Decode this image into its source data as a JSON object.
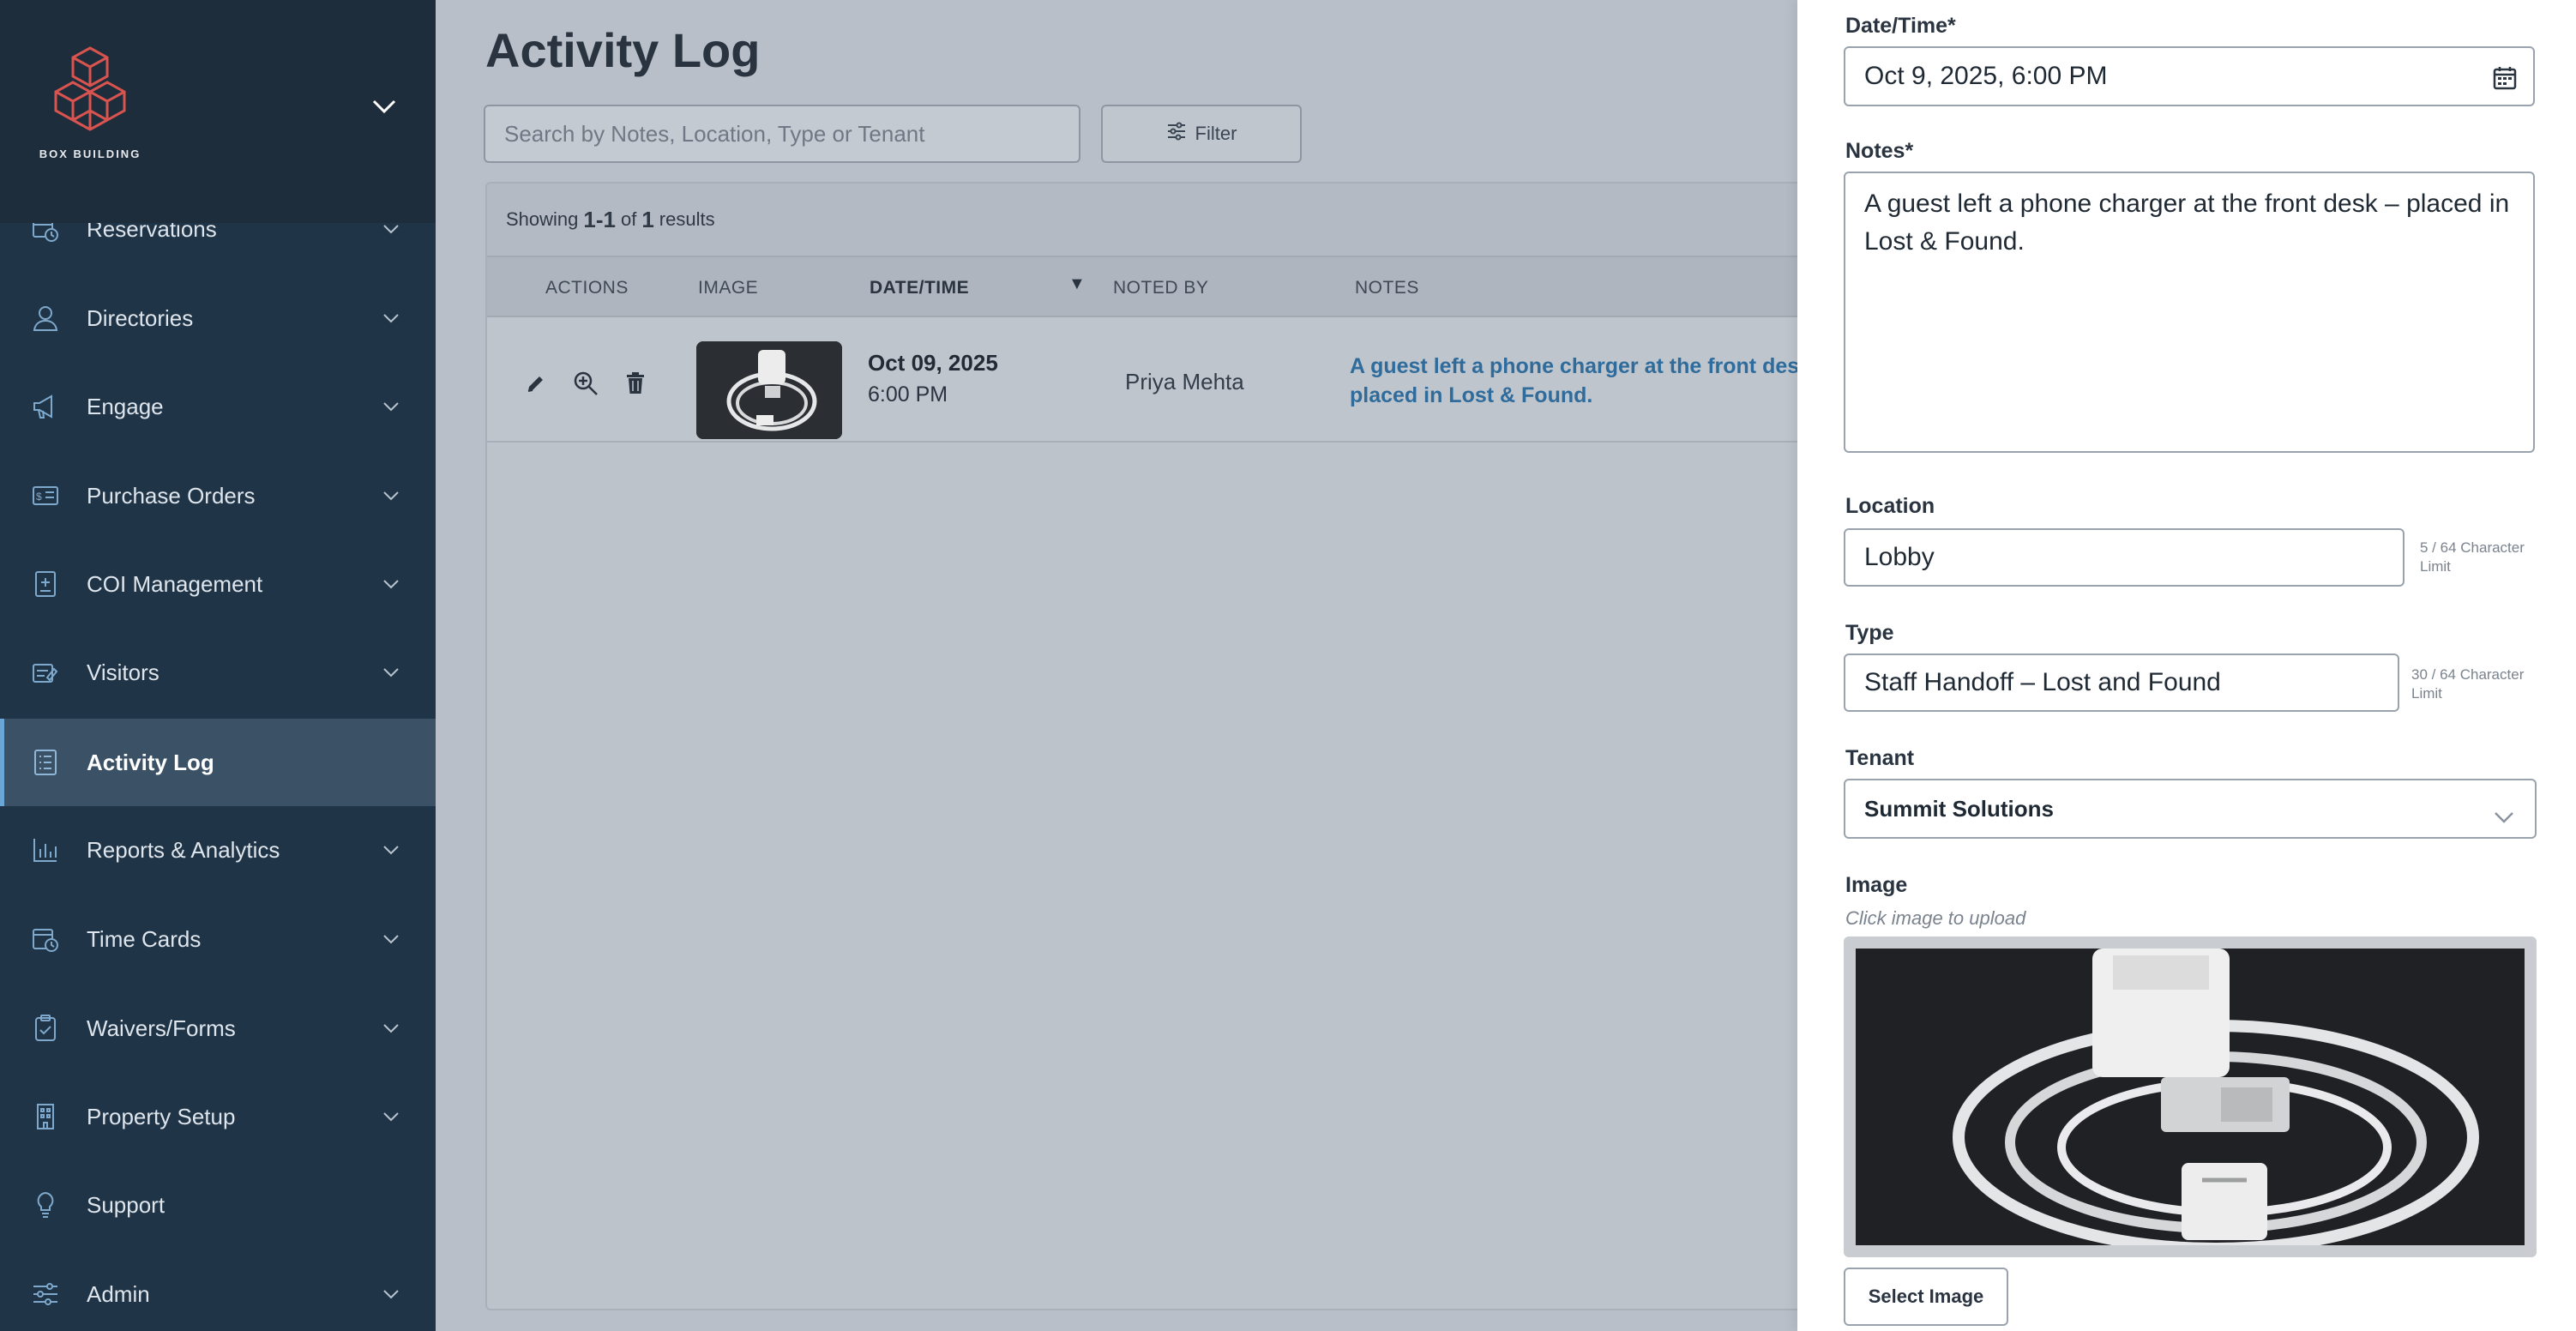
{
  "brand": {
    "name": "BOX BUILDING",
    "accent": "#d9534f"
  },
  "sidebar": {
    "items": [
      {
        "label": "Reservations",
        "icon": "calendar-clock-icon",
        "has_caret": true
      },
      {
        "label": "Directories",
        "icon": "person-icon",
        "has_caret": true
      },
      {
        "label": "Engage",
        "icon": "megaphone-icon",
        "has_caret": true
      },
      {
        "label": "Purchase Orders",
        "icon": "invoice-icon",
        "has_caret": true
      },
      {
        "label": "COI Management",
        "icon": "document-plus-icon",
        "has_caret": true
      },
      {
        "label": "Visitors",
        "icon": "visitor-pass-icon",
        "has_caret": true
      },
      {
        "label": "Activity Log",
        "icon": "list-icon",
        "has_caret": false,
        "active": true
      },
      {
        "label": "Reports & Analytics",
        "icon": "bar-chart-icon",
        "has_caret": true
      },
      {
        "label": "Time Cards",
        "icon": "time-card-icon",
        "has_caret": true
      },
      {
        "label": "Waivers/Forms",
        "icon": "clipboard-check-icon",
        "has_caret": true
      },
      {
        "label": "Property Setup",
        "icon": "building-icon",
        "has_caret": true
      },
      {
        "label": "Support",
        "icon": "lightbulb-icon",
        "has_caret": false
      },
      {
        "label": "Admin",
        "icon": "sliders-icon",
        "has_caret": true
      }
    ]
  },
  "main": {
    "title": "Activity Log",
    "search_placeholder": "Search by Notes, Location, Type or Tenant",
    "filter_label": "Filter",
    "results": {
      "prefix": "Showing",
      "range": "1-1",
      "of": "of",
      "total": "1",
      "suffix": "results"
    },
    "columns": [
      "ACTIONS",
      "IMAGE",
      "DATE/TIME",
      "NOTED BY",
      "NOTES"
    ],
    "rows": [
      {
        "date": "Oct 09, 2025",
        "time": "6:00 PM",
        "noted_by": "Priya Mehta",
        "notes_line1": "A guest left a phone charger at the front desk",
        "notes_line2": "placed in Lost & Found."
      }
    ]
  },
  "panel": {
    "datetime_label": "Date/Time*",
    "datetime_value": "Oct 9, 2025, 6:00 PM",
    "notes_label": "Notes*",
    "notes_value": "A guest left a phone charger at the front desk – placed in Lost & Found.",
    "location_label": "Location",
    "location_value": "Lobby",
    "location_limit": "5 / 64 Character Limit",
    "type_label": "Type",
    "type_value": "Staff Handoff – Lost and Found",
    "type_limit": "30 / 64 Character Limit",
    "tenant_label": "Tenant",
    "tenant_value": "Summit Solutions",
    "image_label": "Image",
    "image_hint": "Click image to upload",
    "select_image_label": "Select Image"
  }
}
